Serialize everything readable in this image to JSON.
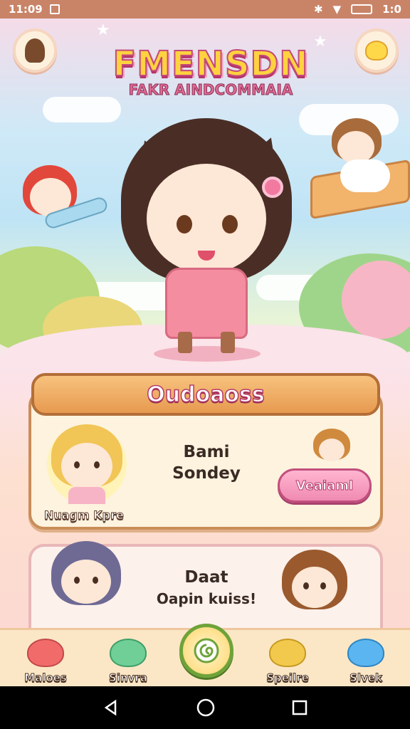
{
  "status_bar": {
    "time": "11:09",
    "battery": "1:0"
  },
  "title": {
    "main": "FMENSDN",
    "subtitle": "FAKR AINDCOMMAIA"
  },
  "panel": {
    "header": "Oudoaoss",
    "character_label": "Nuagm Kpre",
    "line1": "Bami",
    "line2": "Sondey",
    "button_label": "Veaiaml"
  },
  "panel2": {
    "line1": "Daat",
    "line2": "Oapin kuiss!"
  },
  "bottom_nav": {
    "items": [
      {
        "label": "Maloes",
        "color": "#f26b6b"
      },
      {
        "label": "Sinvra",
        "color": "#6fcf97"
      },
      {
        "label": "Speilre",
        "color": "#f2c94c"
      },
      {
        "label": "Slvek",
        "color": "#5bb5f0"
      }
    ]
  },
  "icons": [
    "profile-icon",
    "chicken-icon",
    "swirl-icon",
    "back-icon",
    "home-icon",
    "recents-icon"
  ]
}
